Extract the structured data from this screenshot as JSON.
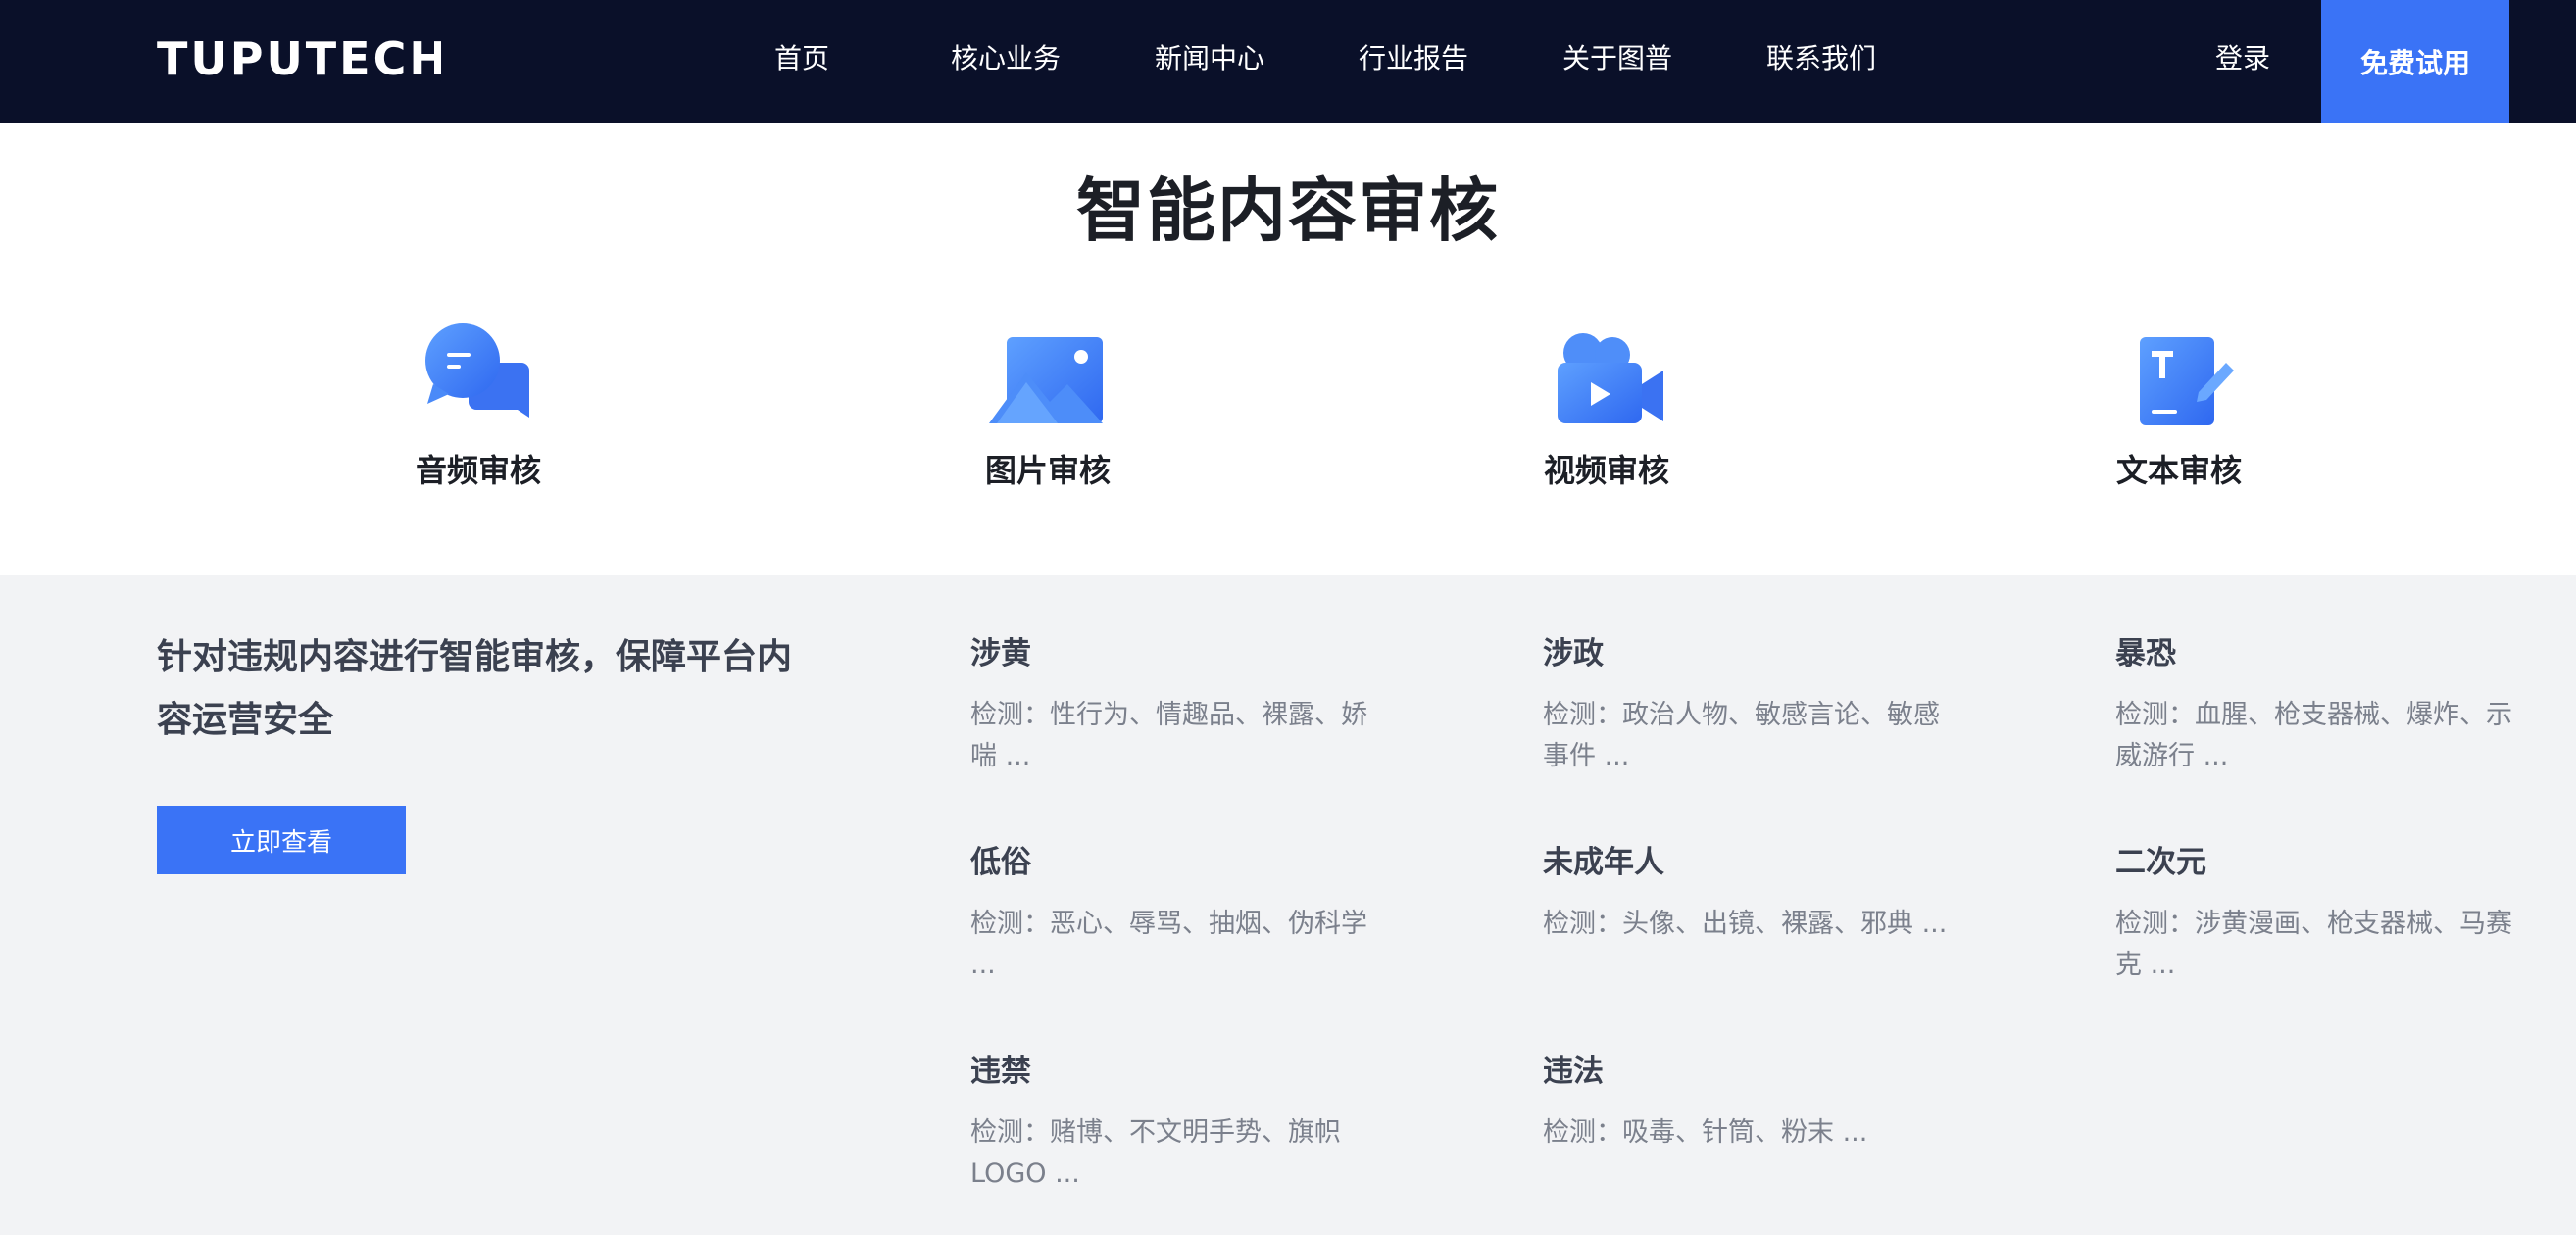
{
  "nav": {
    "logo_text": "TUPUTECH",
    "items": [
      "首页",
      "核心业务",
      "新闻中心",
      "行业报告",
      "关于图普",
      "联系我们"
    ],
    "login": "登录",
    "trial": "免费试用"
  },
  "hero": {
    "title": "智能内容审核",
    "categories": [
      {
        "label": "音频审核",
        "icon": "chat-bubbles-icon"
      },
      {
        "label": "图片审核",
        "icon": "image-icon"
      },
      {
        "label": "视频审核",
        "icon": "video-camera-icon"
      },
      {
        "label": "文本审核",
        "icon": "text-document-icon"
      }
    ]
  },
  "detail": {
    "intro": "针对违规内容进行智能审核，保障平台内容运营安全",
    "cta": "立即查看",
    "risks": [
      {
        "title": "涉黄",
        "desc": "检测：性行为、情趣品、裸露、娇喘 ..."
      },
      {
        "title": "涉政",
        "desc": "检测：政治人物、敏感言论、敏感事件 ..."
      },
      {
        "title": "暴恐",
        "desc": "检测：血腥、枪支器械、爆炸、示威游行 ..."
      },
      {
        "title": "低俗",
        "desc": "检测：恶心、辱骂、抽烟、伪科学 ..."
      },
      {
        "title": "未成年人",
        "desc": "检测：头像、出镜、裸露、邪典 ..."
      },
      {
        "title": "二次元",
        "desc": "检测：涉黄漫画、枪支器械、马赛克 ..."
      },
      {
        "title": "违禁",
        "desc": "检测：赌博、不文明手势、旗帜LOGO ..."
      },
      {
        "title": "违法",
        "desc": "检测：吸毒、针筒、粉末 ..."
      }
    ]
  },
  "colors": {
    "nav_bg": "#0a1029",
    "accent": "#3a73f6",
    "detail_bg": "#f2f3f5"
  }
}
